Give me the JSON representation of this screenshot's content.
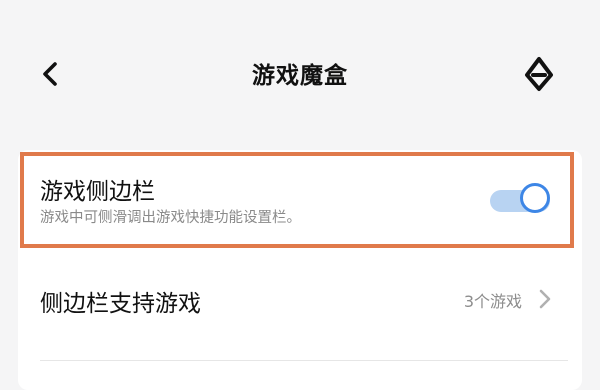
{
  "header": {
    "title": "游戏魔盒",
    "back_icon": "back-arrow-icon",
    "logo_icon": "game-box-logo-icon"
  },
  "sidebar_toggle": {
    "title": "游戏侧边栏",
    "description": "游戏中可侧滑调出游戏快捷功能设置栏。",
    "enabled": true
  },
  "support_games": {
    "title": "侧边栏支持游戏",
    "value": "3个游戏",
    "chevron_icon": "chevron-right-icon"
  },
  "colors": {
    "background": "#f5f5f6",
    "card": "#ffffff",
    "highlight_border": "#e07a4b",
    "toggle_track": "#b8d3f2",
    "toggle_accent": "#3d86e6",
    "secondary_text": "#8a8a8a"
  }
}
